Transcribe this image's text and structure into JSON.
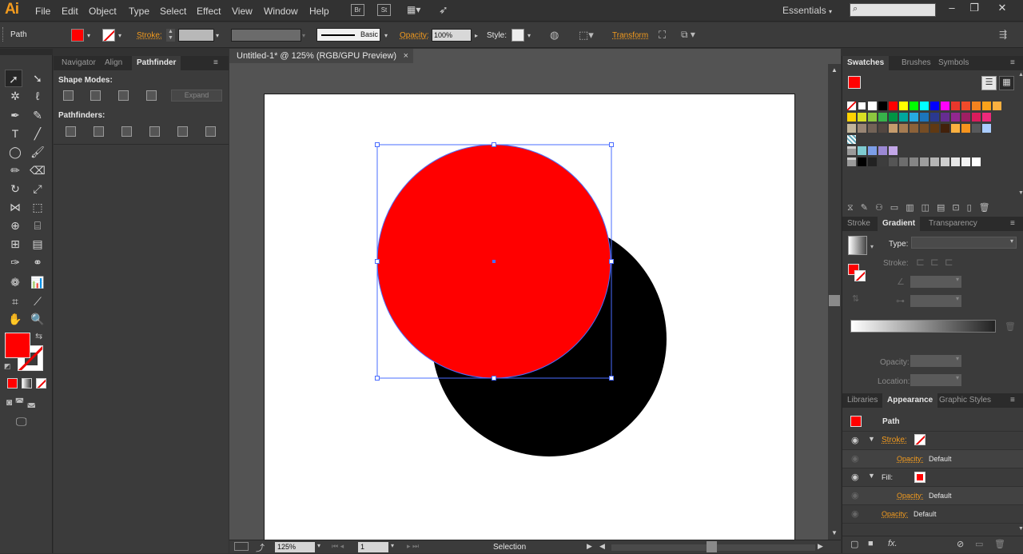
{
  "app": {
    "logo": "Ai",
    "workspace": "Essentials"
  },
  "menu": [
    "File",
    "Edit",
    "Object",
    "Type",
    "Select",
    "Effect",
    "View",
    "Window",
    "Help"
  ],
  "menu_boxes": [
    "Br",
    "St"
  ],
  "control": {
    "selection_label": "Path",
    "stroke_label": "Stroke:",
    "brush_label": "Basic",
    "opacity_label": "Opacity:",
    "opacity_value": "100%",
    "style_label": "Style:",
    "transform_label": "Transform"
  },
  "left_panel": {
    "tabs": [
      "Navigator",
      "Align",
      "Pathfinder"
    ],
    "shape_modes": "Shape Modes:",
    "expand": "Expand",
    "pathfinders": "Pathfinders:"
  },
  "document": {
    "tab_title": "Untitled-1* @ 125% (RGB/GPU Preview)",
    "close": "×"
  },
  "status": {
    "zoom": "125%",
    "page": "1",
    "tool": "Selection"
  },
  "swatches_panel": {
    "tabs": [
      "Swatches",
      "Brushes",
      "Symbols"
    ]
  },
  "gradient_panel": {
    "tabs": [
      "Stroke",
      "Gradient",
      "Transparency"
    ],
    "type_label": "Type:",
    "stroke_label": "Stroke:",
    "opacity_label": "Opacity:",
    "location_label": "Location:"
  },
  "appearance_panel": {
    "tabs": [
      "Libraries",
      "Appearance",
      "Graphic Styles"
    ],
    "object": "Path",
    "stroke_label": "Stroke:",
    "fill_label": "Fill:",
    "opacity_label": "Opacity:",
    "opacity_value": "Default",
    "fx": "fx."
  },
  "colors": {
    "accent": "#f39b1e",
    "fill": "#ff0000",
    "shape2": "#000000",
    "selection": "#4a6cff"
  }
}
